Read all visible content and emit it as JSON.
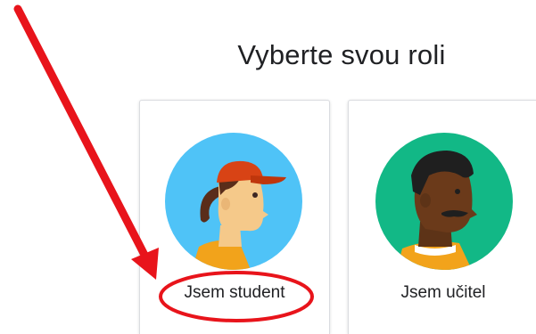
{
  "page": {
    "title": "Vyberte svou roli"
  },
  "roles": [
    {
      "label": "Jsem student",
      "avatar_color": "#4fc3f7",
      "highlighted": true
    },
    {
      "label": "Jsem učitel",
      "avatar_color": "#12b886",
      "highlighted": false
    }
  ],
  "annotation": {
    "arrow_color": "#e8141b",
    "circle_color": "#e8141b"
  }
}
